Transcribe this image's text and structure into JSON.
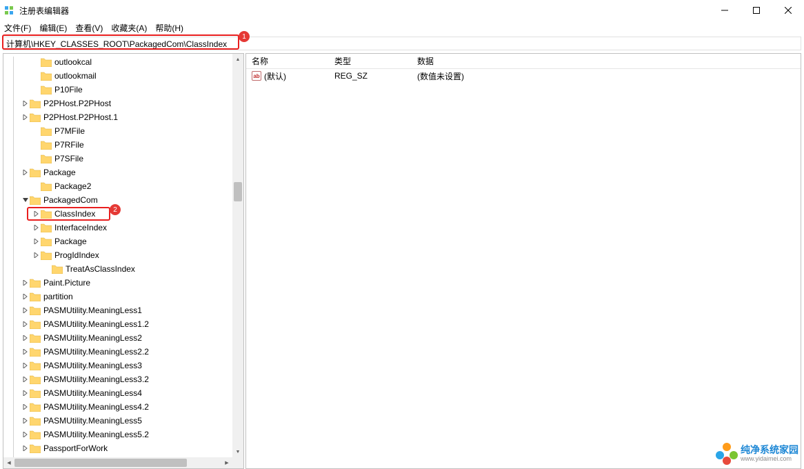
{
  "window": {
    "title": "注册表编辑器"
  },
  "menu": {
    "file": "文件(F)",
    "edit": "编辑(E)",
    "view": "查看(V)",
    "favorites": "收藏夹(A)",
    "help": "帮助(H)"
  },
  "address": {
    "path": "计算机\\HKEY_CLASSES_ROOT\\PackagedCom\\ClassIndex"
  },
  "badges": {
    "one": "1",
    "two": "2"
  },
  "tree": {
    "items": [
      {
        "indent": 2,
        "exp": "",
        "label": "outlookcal"
      },
      {
        "indent": 2,
        "exp": "",
        "label": "outlookmail"
      },
      {
        "indent": 2,
        "exp": "",
        "label": "P10File"
      },
      {
        "indent": 1,
        "exp": ">",
        "label": "P2PHost.P2PHost"
      },
      {
        "indent": 1,
        "exp": ">",
        "label": "P2PHost.P2PHost.1"
      },
      {
        "indent": 2,
        "exp": "",
        "label": "P7MFile"
      },
      {
        "indent": 2,
        "exp": "",
        "label": "P7RFile"
      },
      {
        "indent": 2,
        "exp": "",
        "label": "P7SFile"
      },
      {
        "indent": 1,
        "exp": ">",
        "label": "Package"
      },
      {
        "indent": 2,
        "exp": "",
        "label": "Package2"
      },
      {
        "indent": 1,
        "exp": "v",
        "label": "PackagedCom"
      },
      {
        "indent": 2,
        "exp": ">",
        "label": "ClassIndex",
        "highlight": true
      },
      {
        "indent": 2,
        "exp": ">",
        "label": "InterfaceIndex"
      },
      {
        "indent": 2,
        "exp": ">",
        "label": "Package"
      },
      {
        "indent": 2,
        "exp": ">",
        "label": "ProgIdIndex"
      },
      {
        "indent": 3,
        "exp": "",
        "label": "TreatAsClassIndex"
      },
      {
        "indent": 1,
        "exp": ">",
        "label": "Paint.Picture"
      },
      {
        "indent": 1,
        "exp": ">",
        "label": "partition"
      },
      {
        "indent": 1,
        "exp": ">",
        "label": "PASMUtility.MeaningLess1"
      },
      {
        "indent": 1,
        "exp": ">",
        "label": "PASMUtility.MeaningLess1.2"
      },
      {
        "indent": 1,
        "exp": ">",
        "label": "PASMUtility.MeaningLess2"
      },
      {
        "indent": 1,
        "exp": ">",
        "label": "PASMUtility.MeaningLess2.2"
      },
      {
        "indent": 1,
        "exp": ">",
        "label": "PASMUtility.MeaningLess3"
      },
      {
        "indent": 1,
        "exp": ">",
        "label": "PASMUtility.MeaningLess3.2"
      },
      {
        "indent": 1,
        "exp": ">",
        "label": "PASMUtility.MeaningLess4"
      },
      {
        "indent": 1,
        "exp": ">",
        "label": "PASMUtility.MeaningLess4.2"
      },
      {
        "indent": 1,
        "exp": ">",
        "label": "PASMUtility.MeaningLess5"
      },
      {
        "indent": 1,
        "exp": ">",
        "label": "PASMUtility.MeaningLess5.2"
      },
      {
        "indent": 1,
        "exp": ">",
        "label": "PassportForWork"
      }
    ]
  },
  "list": {
    "cols": {
      "name": "名称",
      "type": "类型",
      "data": "数据"
    },
    "rows": [
      {
        "icon": "ab",
        "name": "(默认)",
        "type": "REG_SZ",
        "data": "(数值未设置)"
      }
    ]
  },
  "watermark": {
    "main": "纯净系统家园",
    "sub": "www.yidaimei.com"
  }
}
